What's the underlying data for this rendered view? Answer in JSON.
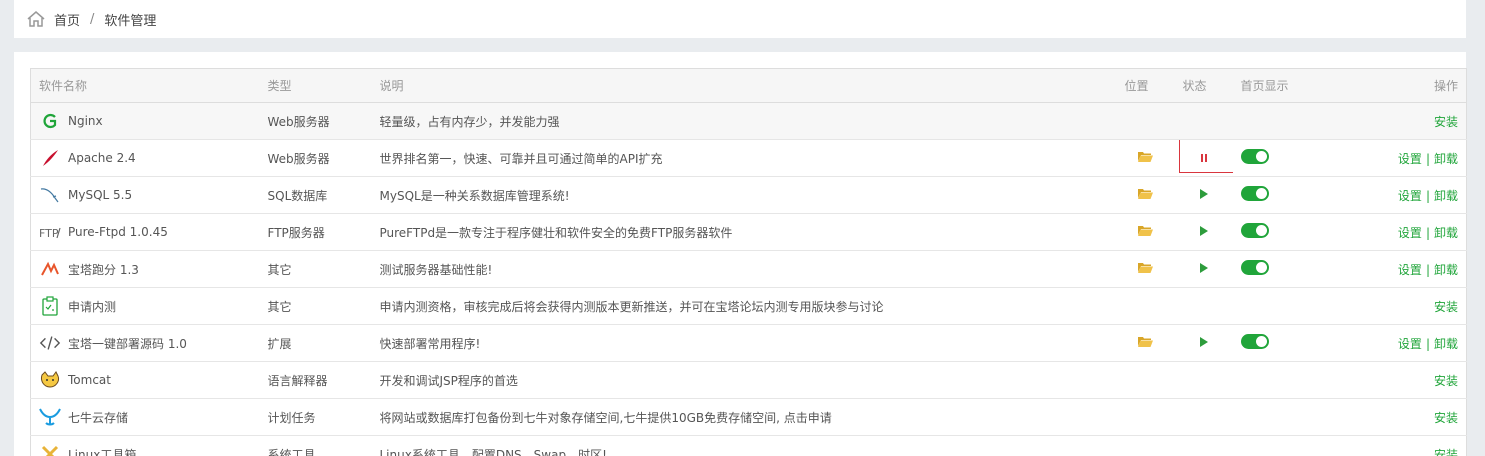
{
  "breadcrumb": {
    "home": "首页",
    "separator": "/",
    "current": "软件管理"
  },
  "columns": {
    "name": "软件名称",
    "type": "类型",
    "desc": "说明",
    "location": "位置",
    "status": "状态",
    "homepage": "首页显示",
    "action": "操作"
  },
  "links": {
    "install": "安装",
    "settings": "设置",
    "uninstall": "卸载",
    "sep": "|"
  },
  "colors": {
    "accent": "#20a53a",
    "stop": "#d9363e",
    "folder": "#e8b338"
  },
  "rows": [
    {
      "name": "Nginx",
      "icon": "nginx-icon",
      "type": "Web服务器",
      "desc": "轻量级，占有内存少，并发能力强",
      "installed": false
    },
    {
      "name": "Apache 2.4",
      "icon": "apache-feather-icon",
      "type": "Web服务器",
      "desc": "世界排名第一，快速、可靠并且可通过简单的API扩充",
      "installed": true,
      "running": true,
      "highlight": true,
      "homepage": true
    },
    {
      "name": "MySQL 5.5",
      "icon": "mysql-dolphin-icon",
      "type": "SQL数据库",
      "desc": "MySQL是一种关系数据库管理系统!",
      "installed": true,
      "running": false,
      "homepage": true
    },
    {
      "name": "Pure-Ftpd 1.0.45",
      "icon": "ftp-icon",
      "type": "FTP服务器",
      "desc": "PureFTPd是一款专注于程序健壮和软件安全的免费FTP服务器软件",
      "installed": true,
      "running": false,
      "homepage": true
    },
    {
      "name": "宝塔跑分 1.3",
      "icon": "benchmark-icon",
      "type": "其它",
      "desc": "测试服务器基础性能!",
      "installed": true,
      "running": false,
      "homepage": true
    },
    {
      "name": "申请内测",
      "icon": "clipboard-icon",
      "type": "其它",
      "desc": "申请内测资格，审核完成后将会获得内测版本更新推送，并可在宝塔论坛内测专用版块参与讨论",
      "installed": false
    },
    {
      "name": "宝塔一键部署源码 1.0",
      "icon": "code-icon",
      "type": "扩展",
      "desc": "快速部署常用程序!",
      "installed": true,
      "running": false,
      "homepage": true
    },
    {
      "name": "Tomcat",
      "icon": "tomcat-icon",
      "type": "语言解释器",
      "desc": "开发和调试JSP程序的首选",
      "installed": false
    },
    {
      "name": "七牛云存储",
      "icon": "qiniu-icon",
      "type": "计划任务",
      "desc": "将网站或数据库打包备份到七牛对象存储空间,七牛提供10GB免费存储空间, 点击申请",
      "installed": false
    },
    {
      "name": "Linux工具箱",
      "icon": "toolbox-icon",
      "type": "系统工具",
      "desc": "Linux系统工具，配置DNS、Swap、时区!",
      "installed": false
    }
  ]
}
